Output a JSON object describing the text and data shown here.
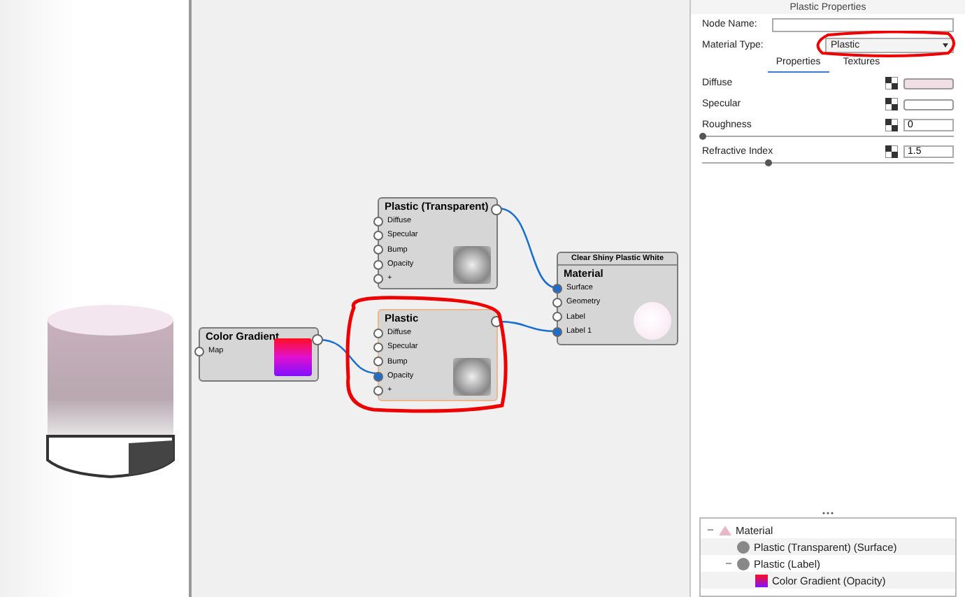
{
  "properties": {
    "title": "Plastic Properties",
    "node_name_label": "Node Name:",
    "material_type_label": "Material Type:",
    "material_type": "Plastic",
    "tabs": [
      {
        "label": "Properties",
        "selected": true
      },
      {
        "label": "Textures",
        "selected": false
      }
    ],
    "params": [
      {
        "kind": "color",
        "label": "Diffuse",
        "color": "#f2dde4"
      },
      {
        "kind": "color",
        "label": "Specular",
        "color": "#ffffff"
      },
      {
        "kind": "slider",
        "label": "Roughness",
        "value": "0",
        "level": 0
      },
      {
        "kind": "slider",
        "label": "Refractive Index",
        "value": "1.5",
        "level": 0.26
      }
    ]
  },
  "nodes": [
    {
      "kind": "shader",
      "title": "Plastic (Transparent)",
      "selected": false,
      "ports": [
        {
          "label": "Diffuse",
          "connected": false
        },
        {
          "label": "Specular",
          "connected": false
        },
        {
          "label": "Bump",
          "connected": false
        },
        {
          "label": "Opacity",
          "connected": false
        },
        {
          "label": "+",
          "connected": false
        }
      ]
    },
    {
      "kind": "shader",
      "title": "Plastic",
      "selected": true,
      "ports": [
        {
          "label": "Diffuse",
          "connected": false
        },
        {
          "label": "Specular",
          "connected": false
        },
        {
          "label": "Bump",
          "connected": false
        },
        {
          "label": "Opacity",
          "connected": true
        },
        {
          "label": "+",
          "connected": false
        }
      ]
    },
    {
      "kind": "gradient",
      "title": "Color Gradient",
      "selected": false,
      "ports": [
        {
          "label": "Map",
          "connected": false
        }
      ]
    },
    {
      "kind": "material",
      "header": "Clear Shiny Plastic White",
      "title": "Material",
      "selected": false,
      "ports": [
        {
          "label": "Surface",
          "connected": true
        },
        {
          "label": "Geometry",
          "connected": false
        },
        {
          "label": "Label",
          "connected": false
        },
        {
          "label": "Label 1",
          "connected": true
        }
      ]
    }
  ],
  "tree": [
    {
      "kind": "material",
      "label": "Material",
      "expanded": true,
      "children": [
        {
          "kind": "sphere",
          "label": "Plastic (Transparent) (Surface)"
        },
        {
          "kind": "sphere",
          "label": "Plastic (Label)",
          "expanded": true,
          "children": [
            {
              "kind": "gradient",
              "label": "Color Gradient (Opacity)"
            }
          ]
        }
      ]
    }
  ]
}
